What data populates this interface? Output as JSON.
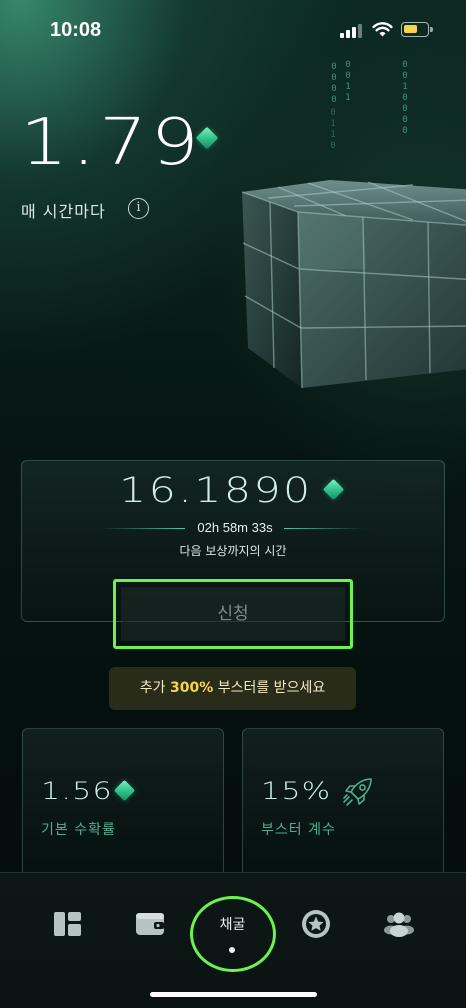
{
  "status_bar": {
    "time": "10:08",
    "battery_color": "#f5d64a"
  },
  "binary_columns": [
    "0000",
    "0011",
    "0110",
    "0010000"
  ],
  "hourly": {
    "rate": "1.79",
    "label": "매 시간마다",
    "info_icon": "info-icon"
  },
  "reward": {
    "amount": "16.1890",
    "timer": "02h 58m 33s",
    "timer_label": "다음 보상까지의 시간",
    "claim_label": "신청"
  },
  "booster_banner": {
    "prefix": "추가 ",
    "highlight": "300%",
    "suffix": " 부스터를 받으세요"
  },
  "stats": {
    "base_rate": {
      "value": "1.56",
      "label": "기본 수확률",
      "icon": "gem-icon"
    },
    "booster": {
      "value": "15%",
      "label": "부스터 계수",
      "icon": "rocket-icon"
    }
  },
  "nav": {
    "items": [
      {
        "name": "dashboard",
        "icon": "dashboard-icon"
      },
      {
        "name": "wallet",
        "icon": "wallet-icon"
      },
      {
        "name": "mining",
        "label": "채굴",
        "active": true
      },
      {
        "name": "rewards",
        "icon": "star-badge-icon"
      },
      {
        "name": "friends",
        "icon": "users-icon"
      }
    ]
  },
  "colors": {
    "accent": "#6cf34e",
    "gem": "#34c48d",
    "banner_highlight": "#f5d64a"
  }
}
